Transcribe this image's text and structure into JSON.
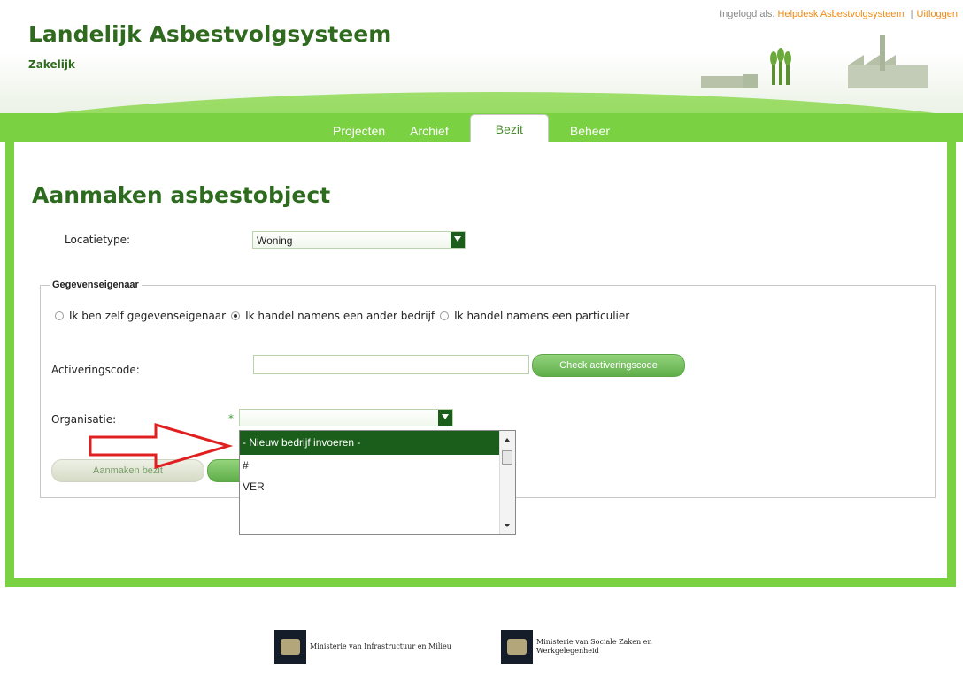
{
  "header": {
    "title": "Landelijk Asbestvolgsysteem",
    "subtitle": "Zakelijk",
    "logged_in_label": "Ingelogd als:",
    "user_link": "Helpdesk Asbestvolgsysteem",
    "separator": "|",
    "logout_link": "Uitloggen"
  },
  "tabs": [
    {
      "label": "Projecten",
      "active": false
    },
    {
      "label": "Archief",
      "active": false
    },
    {
      "label": "Bezit",
      "active": true
    },
    {
      "label": "Beheer",
      "active": false
    }
  ],
  "form": {
    "page_title": "Aanmaken asbestobject",
    "location_type_label": "Locatietype:",
    "location_type_value": "Woning",
    "group_legend": "Gegevenseigenaar",
    "radios": [
      {
        "label": "Ik ben zelf gegevenseigenaar",
        "checked": false
      },
      {
        "label": "Ik handel namens een ander bedrijf",
        "checked": true
      },
      {
        "label": "Ik handel namens een particulier",
        "checked": false
      }
    ],
    "activation_label": "Activeringscode:",
    "activation_value": "",
    "check_button": "Check activeringscode",
    "organisation_label": "Organisatie:",
    "required_mark": "*",
    "organisation_value": "",
    "create_button": "Aanmaken bezit"
  },
  "dropdown": {
    "options": [
      "- Nieuw bedrijf invoeren -",
      "#",
      "VER"
    ],
    "selected_index": 0
  },
  "footer": {
    "logo1": [
      "Ministerie van Infrastructuur en Milieu"
    ],
    "logo2": [
      "Ministerie van Sociale Zaken en",
      "Werkgelegenheid"
    ]
  },
  "colors": {
    "brand_green": "#2f6a1e",
    "panel_green": "#7ad142",
    "select_dark": "#1b5e1b",
    "link_orange": "#f08a14",
    "arrow_red": "#e02020"
  }
}
